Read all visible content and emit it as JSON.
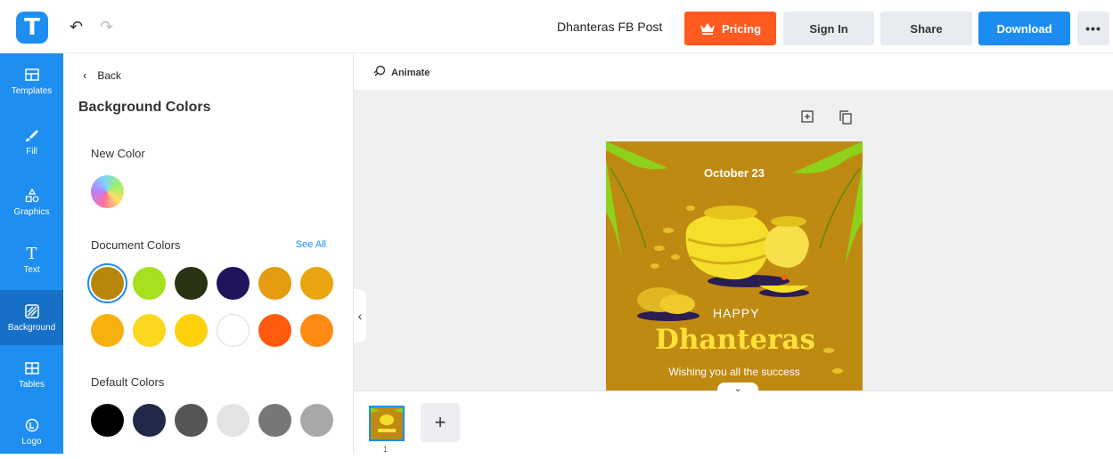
{
  "app": {
    "logo_letter": "T",
    "document_title": "Dhanteras FB Post"
  },
  "toolbar": {
    "pricing_label": "Pricing",
    "signin_label": "Sign In",
    "share_label": "Share",
    "download_label": "Download",
    "more_label": "•••",
    "undo_icon": "↶",
    "redo_icon": "↷"
  },
  "sidebar": {
    "items": [
      {
        "label": "Templates",
        "icon": "templates-icon"
      },
      {
        "label": "Fill",
        "icon": "brush-icon"
      },
      {
        "label": "Graphics",
        "icon": "shapes-icon"
      },
      {
        "label": "Text",
        "icon": "text-icon"
      },
      {
        "label": "Background",
        "icon": "background-icon",
        "active": true
      },
      {
        "label": "Tables",
        "icon": "table-icon"
      },
      {
        "label": "Logo",
        "icon": "logo-icon"
      }
    ]
  },
  "panel": {
    "back_label": "Back",
    "title": "Background Colors",
    "new_color_label": "New Color",
    "document_colors_label": "Document Colors",
    "see_all_label": "See All",
    "default_colors_label": "Default Colors",
    "document_colors": [
      "#b8860b",
      "#a6e01e",
      "#293212",
      "#22145c",
      "#e39b10",
      "#e9a510",
      "#f6b10e",
      "#fcd71f",
      "#fdd20d",
      "#ffffff",
      "#ff5a10",
      "#ff8a14"
    ],
    "default_colors": [
      "#000000",
      "#21294a",
      "#555555",
      "#e3e3e3",
      "#777777",
      "#a8a8a8"
    ]
  },
  "editor": {
    "animate_label": "Animate",
    "collapse_icon": "‹",
    "scroll_icon": "⌄",
    "add_page_icon": "+",
    "page_number": "1"
  },
  "design": {
    "date": "October 23",
    "happy": "HAPPY",
    "title": "Dhanteras",
    "wish": "Wishing you all the success",
    "bg_color": "#bf8a12"
  }
}
